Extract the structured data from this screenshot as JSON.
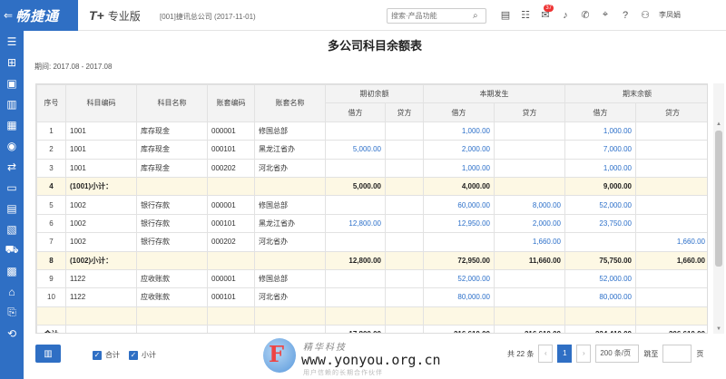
{
  "header": {
    "brand": "畅捷通",
    "edition_mark": "T+",
    "edition_name": "专业版",
    "company": "[001]捷讯总公司",
    "date": "(2017-11-01)",
    "search_placeholder": "搜索·产品功能",
    "notification_count": "37",
    "username": "李凤娟"
  },
  "page": {
    "title": "多公司科目余额表",
    "period_label": "期间:",
    "period_value": "2017.08 - 2017.08"
  },
  "table": {
    "headers": {
      "seq": "序号",
      "code": "科目编码",
      "name": "科目名称",
      "book_code": "账套编码",
      "book_name": "账套名称",
      "opening": "期初余额",
      "current": "本期发生",
      "closing": "期末余额",
      "debit": "借方",
      "credit": "贷方"
    },
    "rows": [
      {
        "type": "data",
        "seq": "1",
        "code": "1001",
        "name": "库存现金",
        "book_code": "000001",
        "book_name": "修国总部",
        "od": "",
        "oc": "",
        "cd": "1,000.00",
        "cc": "",
        "ed": "1,000.00",
        "ec": ""
      },
      {
        "type": "data",
        "seq": "2",
        "code": "1001",
        "name": "库存现金",
        "book_code": "000101",
        "book_name": "黑龙江省办",
        "od": "5,000.00",
        "oc": "",
        "cd": "2,000.00",
        "cc": "",
        "ed": "7,000.00",
        "ec": ""
      },
      {
        "type": "data",
        "seq": "3",
        "code": "1001",
        "name": "库存现金",
        "book_code": "000202",
        "book_name": "河北省办",
        "od": "",
        "oc": "",
        "cd": "1,000.00",
        "cc": "",
        "ed": "1,000.00",
        "ec": ""
      },
      {
        "type": "sub",
        "seq": "4",
        "code": "(1001)小计：",
        "name": "",
        "book_code": "",
        "book_name": "",
        "od": "5,000.00",
        "oc": "",
        "cd": "4,000.00",
        "cc": "",
        "ed": "9,000.00",
        "ec": ""
      },
      {
        "type": "data",
        "seq": "5",
        "code": "1002",
        "name": "银行存款",
        "book_code": "000001",
        "book_name": "修国总部",
        "od": "",
        "oc": "",
        "cd": "60,000.00",
        "cc": "8,000.00",
        "ed": "52,000.00",
        "ec": ""
      },
      {
        "type": "data",
        "seq": "6",
        "code": "1002",
        "name": "银行存款",
        "book_code": "000101",
        "book_name": "黑龙江省办",
        "od": "12,800.00",
        "oc": "",
        "cd": "12,950.00",
        "cc": "2,000.00",
        "ed": "23,750.00",
        "ec": ""
      },
      {
        "type": "data",
        "seq": "7",
        "code": "1002",
        "name": "银行存款",
        "book_code": "000202",
        "book_name": "河北省办",
        "od": "",
        "oc": "",
        "cd": "",
        "cc": "1,660.00",
        "ed": "",
        "ec": "1,660.00"
      },
      {
        "type": "sub",
        "seq": "8",
        "code": "(1002)小计：",
        "name": "",
        "book_code": "",
        "book_name": "",
        "od": "12,800.00",
        "oc": "",
        "cd": "72,950.00",
        "cc": "11,660.00",
        "ed": "75,750.00",
        "ec": "1,660.00"
      },
      {
        "type": "data",
        "seq": "9",
        "code": "1122",
        "name": "应收账款",
        "book_code": "000001",
        "book_name": "修国总部",
        "od": "",
        "oc": "",
        "cd": "52,000.00",
        "cc": "",
        "ed": "52,000.00",
        "ec": ""
      },
      {
        "type": "data",
        "seq": "10",
        "code": "1122",
        "name": "应收账款",
        "book_code": "000101",
        "book_name": "河北省办",
        "od": "",
        "oc": "",
        "cd": "80,000.00",
        "cc": "",
        "ed": "80,000.00",
        "ec": ""
      },
      {
        "type": "sub",
        "seq": "",
        "code": "",
        "name": "",
        "book_code": "",
        "book_name": "",
        "od": "",
        "oc": "",
        "cd": "",
        "cc": "",
        "ed": "",
        "ec": ""
      }
    ],
    "total": {
      "label": "合计",
      "od": "17,800.00",
      "oc": "",
      "cd": "216,610.00",
      "cc": "216,610.00",
      "ed": "224,410.00",
      "ec": "206,610.00"
    }
  },
  "footer": {
    "check_total": "合计",
    "check_subtotal": "小计",
    "total_records": "共 22 条",
    "prev": "‹",
    "current_page": "1",
    "next": "›",
    "page_size": "200 条/页",
    "jump_label": "跳至",
    "page_suffix": "页"
  },
  "watermark": {
    "letter": "F",
    "cn_text": "精华科技",
    "url": "www.yonyou.org.cn",
    "sub": "用户信赖的长期合作伙伴"
  },
  "colors": {
    "accent": "#2f6fc4",
    "link_value": "#2b6fc9",
    "subtotal_bg": "#fdf8e4"
  }
}
